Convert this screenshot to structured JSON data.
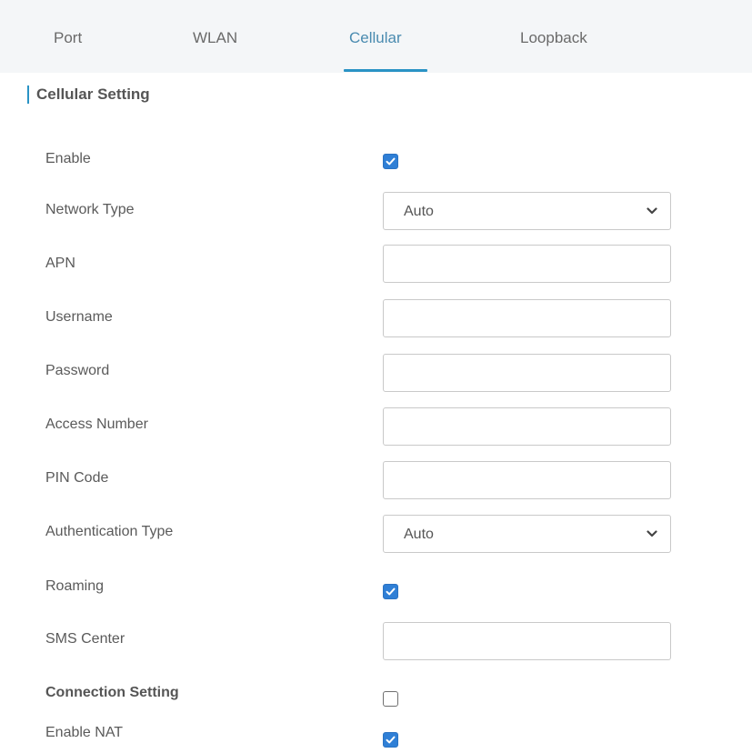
{
  "tabs": [
    {
      "label": "Port",
      "active": false
    },
    {
      "label": "WLAN",
      "active": false
    },
    {
      "label": "Cellular",
      "active": true
    },
    {
      "label": "Loopback",
      "active": false
    }
  ],
  "section": {
    "title": "Cellular Setting"
  },
  "fields": {
    "enable": {
      "label": "Enable",
      "checked": true
    },
    "network_type": {
      "label": "Network Type",
      "value": "Auto"
    },
    "apn": {
      "label": "APN",
      "value": ""
    },
    "username": {
      "label": "Username",
      "value": ""
    },
    "password": {
      "label": "Password",
      "value": ""
    },
    "access_number": {
      "label": "Access Number",
      "value": ""
    },
    "pin_code": {
      "label": "PIN Code",
      "value": ""
    },
    "authentication_type": {
      "label": "Authentication Type",
      "value": "Auto"
    },
    "roaming": {
      "label": "Roaming",
      "checked": true
    },
    "sms_center": {
      "label": "SMS Center",
      "value": ""
    },
    "connection_setting": {
      "label": "Connection Setting",
      "checked": false
    },
    "enable_nat": {
      "label": "Enable NAT",
      "checked": true
    }
  },
  "colors": {
    "accent": "#2a93c5",
    "checkbox_checked": "#2f7fd6",
    "tab_bar_bg": "#f4f6f8"
  }
}
